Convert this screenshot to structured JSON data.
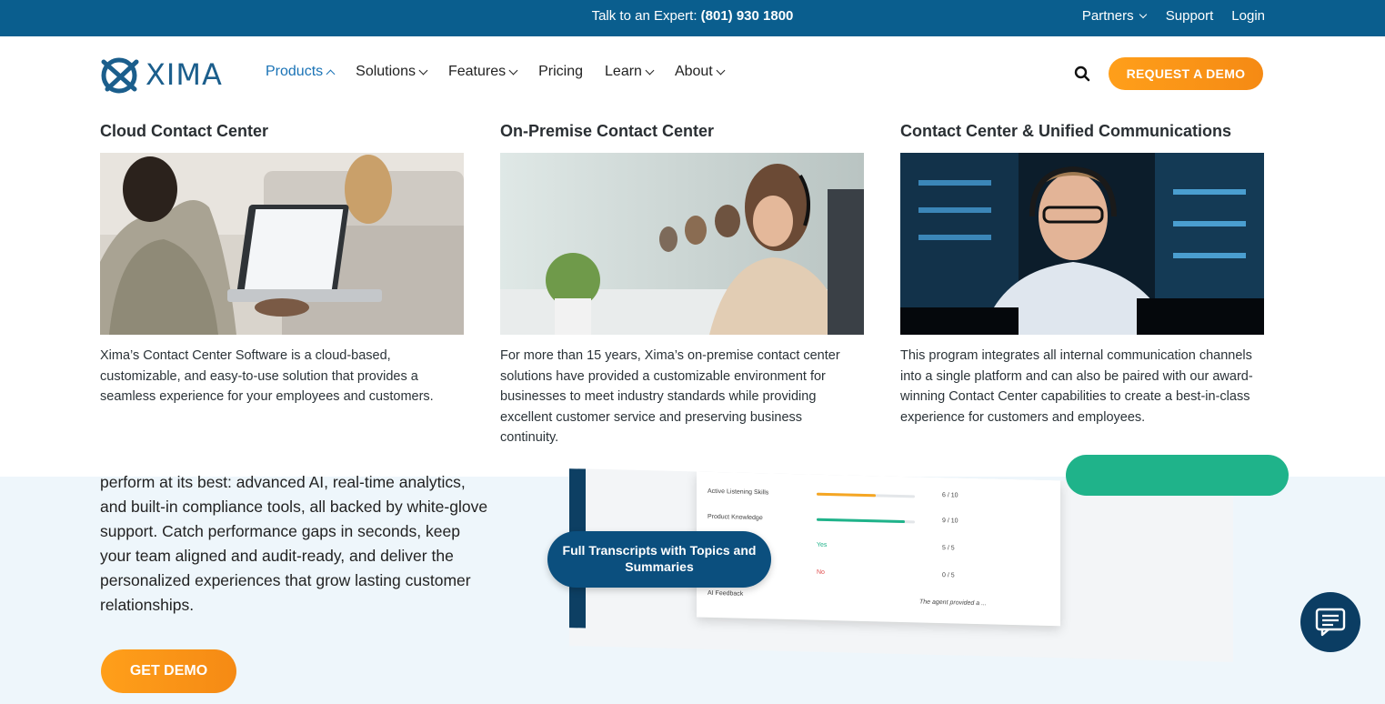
{
  "topbar": {
    "expert_label": "Talk to an Expert: ",
    "expert_phone": "(801) 930 1800",
    "partners": "Partners",
    "support": "Support",
    "login": "Login"
  },
  "header": {
    "logo_text": "XIMA",
    "nav": {
      "products": "Products",
      "solutions": "Solutions",
      "features": "Features",
      "pricing": "Pricing",
      "learn": "Learn",
      "about": "About"
    },
    "demo_button": "REQUEST A DEMO"
  },
  "menu": {
    "cloud": {
      "title": "Cloud Contact Center",
      "description": "Xima’s Contact Center Software is a cloud-based, customizable, and easy-to-use solution that provides a seamless experience for your employees and customers."
    },
    "onprem": {
      "title": "On-Premise Contact Center",
      "description": "For more than 15 years, Xima’s on-premise contact center solutions have provided a customizable environment for businesses to meet industry standards while providing excellent customer service and preserving business continuity."
    },
    "ucc": {
      "title": "Contact Center & Unified Communications",
      "description": "This program integrates all internal communication channels into a single platform and can also be paired with our award-winning Contact Center capabilities to create a best-in-class experience for customers and employees."
    }
  },
  "hero": {
    "text": "perform at its best: advanced AI, real-time analytics, and built-in compliance tools, all backed by white-glove support. Catch performance gaps in seconds, keep your team aligned and audit-ready, and deliver the personalized experiences that grow lasting customer relationships.",
    "cta": "GET DEMO",
    "badge": "Full Transcripts with Topics and Summaries"
  },
  "mock": {
    "rows": [
      {
        "label": "Active Listening Skills",
        "score": "6 / 10",
        "fill": 0.6,
        "color": "#f5a623"
      },
      {
        "label": "Product Knowledge",
        "score": "9 / 10",
        "fill": 0.9,
        "color": "#1fb38a"
      },
      {
        "label": "Yes",
        "score": "5 / 5"
      },
      {
        "label": "No",
        "score": "0 / 5"
      },
      {
        "label": "AI Feedback",
        "score": "The agent provided a ..."
      }
    ]
  },
  "colors": {
    "topbar": "#0a5e8e",
    "accent_orange": "#f7941d",
    "nav_active": "#1a73b6"
  }
}
